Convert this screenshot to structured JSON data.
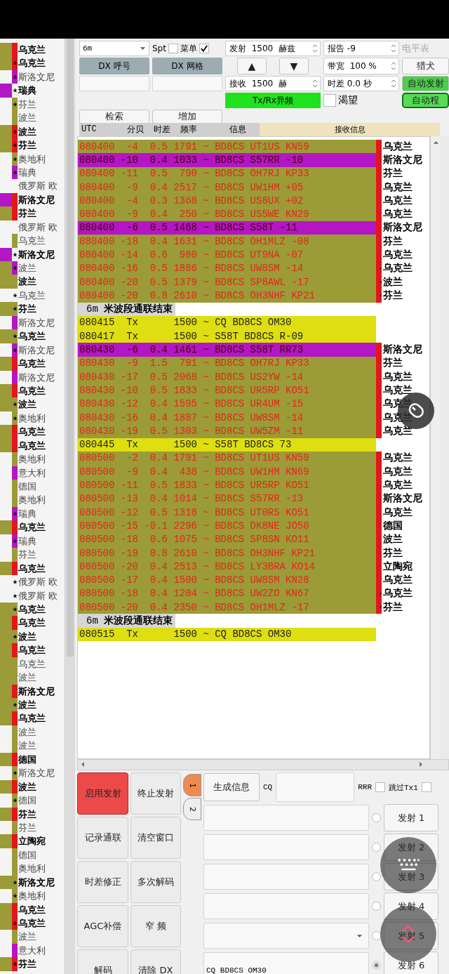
{
  "countries": [
    {
      "name": "乌克兰",
      "bold": true,
      "star": false,
      "kind": "olive",
      "color": "#e3161a"
    },
    {
      "name": "乌克兰",
      "bold": true,
      "star": true,
      "kind": "olive",
      "color": "#e3161a"
    },
    {
      "name": "斯洛文尼",
      "bold": false,
      "star": true,
      "kind": "plain",
      "color": "#b316c4"
    },
    {
      "name": "瑞典",
      "bold": true,
      "star": true,
      "kind": "magenta"
    },
    {
      "name": "芬兰",
      "bold": false,
      "star": true,
      "kind": "plain",
      "color": "#9b9b37"
    },
    {
      "name": "波兰",
      "bold": false,
      "star": false,
      "kind": "plain",
      "color": "#9b9b37"
    },
    {
      "name": "波兰",
      "bold": true,
      "star": true,
      "kind": "olive",
      "color": "#e3161a"
    },
    {
      "name": "芬兰",
      "bold": true,
      "star": true,
      "kind": "olive",
      "color": "#e3161a"
    },
    {
      "name": "奥地利",
      "bold": false,
      "star": true,
      "kind": "plain",
      "color": "#9b9b37"
    },
    {
      "name": "瑞典",
      "bold": false,
      "star": true,
      "kind": "plain",
      "color": "#b316c4"
    },
    {
      "name": "俄罗斯 欧",
      "bold": false,
      "star": false,
      "kind": "plain"
    },
    {
      "name": "斯洛文尼",
      "bold": true,
      "star": false,
      "kind": "magenta",
      "color": "#e3161a"
    },
    {
      "name": "芬兰",
      "bold": true,
      "star": false,
      "kind": "olive",
      "color": "#e3161a"
    },
    {
      "name": "俄罗斯 欧",
      "bold": false,
      "star": false,
      "kind": "plain"
    },
    {
      "name": "乌克兰",
      "bold": false,
      "star": false,
      "kind": "plain",
      "color": "#9b9b37"
    },
    {
      "name": "斯洛文尼",
      "bold": true,
      "star": true,
      "kind": "magenta"
    },
    {
      "name": "波兰",
      "bold": false,
      "star": true,
      "kind": "olive",
      "color": "#b316c4"
    },
    {
      "name": "波兰",
      "bold": true,
      "star": false,
      "kind": "olive",
      "color": "#9b9b37"
    },
    {
      "name": "乌克兰",
      "bold": false,
      "star": true,
      "kind": "plain"
    },
    {
      "name": "芬兰",
      "bold": true,
      "star": true,
      "kind": "olive",
      "color": "#9b9b37"
    },
    {
      "name": "斯洛文尼",
      "bold": false,
      "star": false,
      "kind": "plain",
      "color": "#b316c4"
    },
    {
      "name": "乌克兰",
      "bold": true,
      "star": true,
      "kind": "olive",
      "color": "#9b9b37"
    },
    {
      "name": "斯洛文尼",
      "bold": false,
      "star": true,
      "kind": "plain",
      "color": "#b316c4"
    },
    {
      "name": "乌克兰",
      "bold": true,
      "star": false,
      "kind": "olive",
      "color": "#e3161a"
    },
    {
      "name": "斯洛文尼",
      "bold": false,
      "star": false,
      "kind": "plain",
      "color": "#b316c4"
    },
    {
      "name": "乌克兰",
      "bold": true,
      "star": false,
      "kind": "olive",
      "color": "#e3161a"
    },
    {
      "name": "波兰",
      "bold": true,
      "star": true,
      "kind": "olive",
      "color": "#9b9b37"
    },
    {
      "name": "奥地利",
      "bold": false,
      "star": true,
      "kind": "plain",
      "color": "#9b9b37"
    },
    {
      "name": "乌克兰",
      "bold": true,
      "star": false,
      "kind": "olive",
      "color": "#e3161a"
    },
    {
      "name": "乌克兰",
      "bold": true,
      "star": false,
      "kind": "olive",
      "color": "#e3161a"
    },
    {
      "name": "奥地利",
      "bold": false,
      "star": false,
      "kind": "plain",
      "color": "#9b9b37"
    },
    {
      "name": "意大利",
      "bold": false,
      "star": false,
      "kind": "plain",
      "color": "#b316c4"
    },
    {
      "name": "德国",
      "bold": false,
      "star": false,
      "kind": "plain",
      "color": "#9b9b37"
    },
    {
      "name": "奥地利",
      "bold": false,
      "star": false,
      "kind": "plain",
      "color": "#9b9b37"
    },
    {
      "name": "瑞典",
      "bold": false,
      "star": true,
      "kind": "plain",
      "color": "#b316c4"
    },
    {
      "name": "乌克兰",
      "bold": true,
      "star": false,
      "kind": "olive",
      "color": "#e3161a"
    },
    {
      "name": "瑞典",
      "bold": false,
      "star": true,
      "kind": "plain",
      "color": "#b316c4"
    },
    {
      "name": "芬兰",
      "bold": false,
      "star": false,
      "kind": "plain",
      "color": "#9b9b37"
    },
    {
      "name": "乌克兰",
      "bold": true,
      "star": false,
      "kind": "olive",
      "color": "#e3161a"
    },
    {
      "name": "俄罗斯 欧",
      "bold": false,
      "star": true,
      "kind": "plain"
    },
    {
      "name": "俄罗斯 欧",
      "bold": false,
      "star": true,
      "kind": "plain"
    },
    {
      "name": "乌克兰",
      "bold": true,
      "star": true,
      "kind": "olive",
      "color": "#9b9b37"
    },
    {
      "name": "乌克兰",
      "bold": true,
      "star": false,
      "kind": "olive",
      "color": "#e3161a"
    },
    {
      "name": "波兰",
      "bold": true,
      "star": true,
      "kind": "olive",
      "color": "#9b9b37"
    },
    {
      "name": "乌克兰",
      "bold": true,
      "star": false,
      "kind": "olive",
      "color": "#e3161a"
    },
    {
      "name": "乌克兰",
      "bold": false,
      "star": false,
      "kind": "olive",
      "color": "#9b9b37"
    },
    {
      "name": "波兰",
      "bold": false,
      "star": false,
      "kind": "olive",
      "color": "#9b9b37"
    },
    {
      "name": "斯洛文尼",
      "bold": true,
      "star": false,
      "kind": "olive",
      "color": "#e3161a"
    },
    {
      "name": "波兰",
      "bold": true,
      "star": true,
      "kind": "olive",
      "color": "#9b9b37"
    },
    {
      "name": "乌克兰",
      "bold": true,
      "star": false,
      "kind": "olive",
      "color": "#e3161a"
    },
    {
      "name": "波兰",
      "bold": false,
      "star": false,
      "kind": "plain",
      "color": "#9b9b37"
    },
    {
      "name": "波兰",
      "bold": false,
      "star": false,
      "kind": "plain",
      "color": "#9b9b37"
    },
    {
      "name": "德国",
      "bold": true,
      "star": false,
      "kind": "olive",
      "color": "#e3161a"
    },
    {
      "name": "斯洛文尼",
      "bold": false,
      "star": true,
      "kind": "plain",
      "color": "#9b9b37"
    },
    {
      "name": "波兰",
      "bold": true,
      "star": false,
      "kind": "olive",
      "color": "#e3161a"
    },
    {
      "name": "德国",
      "bold": false,
      "star": true,
      "kind": "plain",
      "color": "#9b9b37"
    },
    {
      "name": "芬兰",
      "bold": true,
      "star": false,
      "kind": "olive",
      "color": "#e3161a"
    },
    {
      "name": "芬兰",
      "bold": false,
      "star": false,
      "kind": "plain",
      "color": "#9b9b37"
    },
    {
      "name": "立陶宛",
      "bold": true,
      "star": false,
      "kind": "olive",
      "color": "#e3161a"
    },
    {
      "name": "德国",
      "bold": false,
      "star": false,
      "kind": "plain",
      "color": "#9b9b37"
    },
    {
      "name": "奥地利",
      "bold": false,
      "star": false,
      "kind": "plain",
      "color": "#9b9b37"
    },
    {
      "name": "斯洛文尼",
      "bold": true,
      "star": true,
      "kind": "olive",
      "color": "#9b9b37"
    },
    {
      "name": "奥地利",
      "bold": false,
      "star": true,
      "kind": "plain",
      "color": "#9b9b37"
    },
    {
      "name": "乌克兰",
      "bold": true,
      "star": false,
      "kind": "olive",
      "color": "#e3161a"
    },
    {
      "name": "乌克兰",
      "bold": true,
      "star": true,
      "kind": "olive",
      "color": "#e3161a"
    },
    {
      "name": "波兰",
      "bold": false,
      "star": false,
      "kind": "plain",
      "color": "#9b9b37"
    },
    {
      "name": "意大利",
      "bold": false,
      "star": false,
      "kind": "plain",
      "color": "#b316c4"
    },
    {
      "name": "芬兰",
      "bold": true,
      "star": true,
      "kind": "olive",
      "color": "#e3161a"
    }
  ],
  "controls": {
    "band_select": "6m",
    "spt": {
      "label": "Spt",
      "checked": false
    },
    "menu": {
      "label": "菜单",
      "checked": true
    },
    "tx_freq": {
      "label": "发射",
      "value": "1500",
      "unit": "赫兹"
    },
    "report": {
      "label": "报告",
      "value": "-9"
    },
    "meter": {
      "label": "电平表",
      "disabled": true
    },
    "dx_call": "DX 呼号",
    "dx_grid": "DX 网格",
    "up": "▲",
    "down": "▼",
    "bandwidth": {
      "label": "带宽",
      "value": "100",
      "unit": "%"
    },
    "hound": "猎犬",
    "rx_freq": {
      "label": "接收",
      "value": "1500",
      "unit": "赫"
    },
    "time_offset": {
      "label": "时差",
      "value": "0.0",
      "unit": "秒"
    },
    "auto_tx": {
      "label": "自动发射",
      "on": true
    },
    "split": {
      "label": "Tx/Rx异频",
      "on": true
    },
    "wish": {
      "label": "渴望",
      "checked": false
    },
    "auto_seq": {
      "label": "自动程",
      "on": true
    },
    "search": "检索",
    "add": "增加"
  },
  "header": {
    "columns": [
      "UTC",
      "分贝",
      "时差",
      "频率",
      "信息"
    ],
    "rx_title": "接收信息"
  },
  "log": [
    {
      "kind": "rx",
      "utc": "080400",
      "db": "-4",
      "dt": "0.5",
      "freq": "1791",
      "msg": "~ BD8CS UT1US KN59",
      "country": "乌克兰",
      "dot": false
    },
    {
      "kind": "hl",
      "utc": "080400",
      "db": "-10",
      "dt": "0.4",
      "freq": "1033",
      "msg": "~ BD8CS S57RR -10",
      "country": "斯洛文尼",
      "dot": false
    },
    {
      "kind": "rx",
      "utc": "080400",
      "db": "-11",
      "dt": "0.5",
      "freq": "790",
      "msg": "~ BD8CS OH7RJ KP33",
      "country": "芬兰",
      "dot": false
    },
    {
      "kind": "rx",
      "utc": "080400",
      "db": "-9",
      "dt": "0.4",
      "freq": "2517",
      "msg": "~ BD8CS UW1HM +05",
      "country": "乌克兰",
      "dot": false
    },
    {
      "kind": "rx",
      "utc": "080400",
      "db": "-4",
      "dt": "0.3",
      "freq": "1368",
      "msg": "~ BD8CS US8UX +02",
      "country": "乌克兰",
      "dot": false
    },
    {
      "kind": "rx",
      "utc": "080400",
      "db": "-9",
      "dt": "0.4",
      "freq": "250",
      "msg": "~ BD8CS US5WE KN29",
      "country": "乌克兰",
      "dot": false
    },
    {
      "kind": "hl",
      "utc": "080400",
      "db": "-6",
      "dt": "0.5",
      "freq": "1468",
      "msg": "~ BD8CS S58T -11",
      "country": "斯洛文尼",
      "dot": false
    },
    {
      "kind": "rx",
      "utc": "080400",
      "db": "-18",
      "dt": "0.4",
      "freq": "1631",
      "msg": "~ BD8CS OH1MLZ -08",
      "country": "芬兰",
      "dot": false
    },
    {
      "kind": "rx",
      "utc": "080400",
      "db": "-14",
      "dt": "0.6",
      "freq": "980",
      "msg": "~ BD8CS UT9NA -07",
      "country": "乌克兰",
      "dot": false
    },
    {
      "kind": "rx",
      "utc": "080400",
      "db": "-16",
      "dt": "0.5",
      "freq": "1886",
      "msg": "~ BD8CS UW8SM -14",
      "country": "乌克兰",
      "dot": true
    },
    {
      "kind": "rx",
      "utc": "080400",
      "db": "-20",
      "dt": "0.5",
      "freq": "1379",
      "msg": "~ BD8CS SP8AWL -17",
      "country": "波兰",
      "dot": true
    },
    {
      "kind": "rx",
      "utc": "080400",
      "db": "-20",
      "dt": "0.8",
      "freq": "2610",
      "msg": "~ BD8CS OH3NHF KP21",
      "country": "芬兰",
      "dot": true
    },
    {
      "kind": "sep",
      "band": "6m",
      "text": "米波段通联结束"
    },
    {
      "kind": "tx",
      "utc": "080415",
      "db": "Tx",
      "freq": "1500",
      "msg": "~ CQ BD8CS OM30"
    },
    {
      "kind": "tx",
      "utc": "080417",
      "db": "Tx",
      "freq": "1500",
      "msg": "~ S58T BD8CS R-09"
    },
    {
      "kind": "hl",
      "utc": "080430",
      "db": "-6",
      "dt": "0.4",
      "freq": "1461",
      "msg": "~ BD8CS S58T RR73",
      "country": "斯洛文尼",
      "dot": false
    },
    {
      "kind": "rx",
      "utc": "080430",
      "db": "-9",
      "dt": "1.5",
      "freq": "791",
      "msg": "~ BD8CS OH7RJ KP33",
      "country": "芬兰",
      "dot": false
    },
    {
      "kind": "rx",
      "utc": "080430",
      "db": "-17",
      "dt": "0.5",
      "freq": "2068",
      "msg": "~ BD8CS US2YW -14",
      "country": "乌克兰",
      "dot": false
    },
    {
      "kind": "rx",
      "utc": "080430",
      "db": "-10",
      "dt": "0.5",
      "freq": "1833",
      "msg": "~ BD8CS UR5RP KO51",
      "country": "乌克兰",
      "dot": false
    },
    {
      "kind": "rx",
      "utc": "080430",
      "db": "-12",
      "dt": "0.4",
      "freq": "1595",
      "msg": "~ BD8CS UR4UM -15",
      "country": "乌克兰",
      "dot": false
    },
    {
      "kind": "rx",
      "utc": "080430",
      "db": "-16",
      "dt": "0.4",
      "freq": "1887",
      "msg": "~ BD8CS UW8SM -14",
      "country": "乌克兰",
      "dot": false
    },
    {
      "kind": "rx",
      "utc": "080430",
      "db": "-19",
      "dt": "0.5",
      "freq": "1303",
      "msg": "~ BD8CS UW5ZM -11",
      "country": "乌克兰",
      "dot": false
    },
    {
      "kind": "tx",
      "utc": "080445",
      "db": "Tx",
      "freq": "1500",
      "msg": "~ S58T BD8CS 73"
    },
    {
      "kind": "rx",
      "utc": "080500",
      "db": "-2",
      "dt": "0.4",
      "freq": "1791",
      "msg": "~ BD8CS UT1US KN59",
      "country": "乌克兰",
      "dot": false
    },
    {
      "kind": "rx",
      "utc": "080500",
      "db": "-9",
      "dt": "0.4",
      "freq": "438",
      "msg": "~ BD8CS UW1HM KN69",
      "country": "乌克兰",
      "dot": false
    },
    {
      "kind": "rx",
      "utc": "080500",
      "db": "-11",
      "dt": "0.5",
      "freq": "1833",
      "msg": "~ BD8CS UR5RP KO51",
      "country": "乌克兰",
      "dot": false
    },
    {
      "kind": "rx",
      "utc": "080500",
      "db": "-13",
      "dt": "0.4",
      "freq": "1014",
      "msg": "~ BD8CS S57RR -13",
      "country": "斯洛文尼",
      "dot": false
    },
    {
      "kind": "rx",
      "utc": "080500",
      "db": "-12",
      "dt": "0.5",
      "freq": "1318",
      "msg": "~ BD8CS UT0RS KO51",
      "country": "乌克兰",
      "dot": false
    },
    {
      "kind": "rx",
      "utc": "080500",
      "db": "-15",
      "dt": "-0.1",
      "freq": "2296",
      "msg": "~ BD8CS DK8NE JO50",
      "country": "德国",
      "dot": false
    },
    {
      "kind": "rx",
      "utc": "080500",
      "db": "-18",
      "dt": "0.6",
      "freq": "1075",
      "msg": "~ BD8CS SP8SN KO11",
      "country": "波兰",
      "dot": false
    },
    {
      "kind": "rx",
      "utc": "080500",
      "db": "-19",
      "dt": "0.8",
      "freq": "2610",
      "msg": "~ BD8CS OH3NHF KP21",
      "country": "芬兰",
      "dot": false
    },
    {
      "kind": "rx",
      "utc": "080500",
      "db": "-20",
      "dt": "0.4",
      "freq": "2513",
      "msg": "~ BD8CS LY3BRA KO14",
      "country": "立陶宛",
      "dot": false
    },
    {
      "kind": "rx",
      "utc": "080500",
      "db": "-17",
      "dt": "0.4",
      "freq": "1500",
      "msg": "~ BD8CS UW8SM KN28",
      "country": "乌克兰",
      "dot": false
    },
    {
      "kind": "rx",
      "utc": "080500",
      "db": "-18",
      "dt": "0.4",
      "freq": "1204",
      "msg": "~ BD8CS UW2ZO KN67",
      "country": "乌克兰",
      "dot": true
    },
    {
      "kind": "rx",
      "utc": "080500",
      "db": "-20",
      "dt": "0.4",
      "freq": "2350",
      "msg": "~ BD8CS OH1MLZ -17",
      "country": "芬兰",
      "dot": true
    },
    {
      "kind": "sep",
      "band": "6m",
      "text": "米波段通联结束"
    },
    {
      "kind": "tx",
      "utc": "080515",
      "db": "Tx",
      "freq": "1500",
      "msg": "~ CQ BD8CS OM30"
    }
  ],
  "buttons": [
    {
      "label": "启用发射",
      "on": true
    },
    {
      "label": "终止发射",
      "on": false
    },
    {
      "label": "记录通联",
      "on": false
    },
    {
      "label": "清空窗口",
      "on": false
    },
    {
      "label": "时差修正",
      "on": false
    },
    {
      "label": "多次解码",
      "on": false
    },
    {
      "label": "AGC补偿",
      "on": false
    },
    {
      "label": "窄 频",
      "on": false
    },
    {
      "label": "解码",
      "on": false
    },
    {
      "label": "清除 DX",
      "on": false
    }
  ],
  "tabs": [
    {
      "label": "1",
      "selected": true
    },
    {
      "label": "2",
      "selected": false
    }
  ],
  "generate": "生成信息",
  "cq_label": "CQ",
  "rrr": {
    "label": "RRR",
    "checked": false
  },
  "skip_tx1": {
    "label": "跳过Tx1",
    "checked": false
  },
  "messages": [
    {
      "kind": "field",
      "selected": false,
      "button": "发射 1"
    },
    {
      "kind": "field",
      "selected": false,
      "button": "发射 2"
    },
    {
      "kind": "field",
      "selected": false,
      "button": "发射 3"
    },
    {
      "kind": "field",
      "selected": false,
      "button": "发射 4"
    },
    {
      "kind": "combo",
      "selected": false,
      "button": "发射 5"
    },
    {
      "kind": "field",
      "selected": true,
      "button": "发射 6",
      "value": "CQ BD8CS OM30"
    }
  ]
}
